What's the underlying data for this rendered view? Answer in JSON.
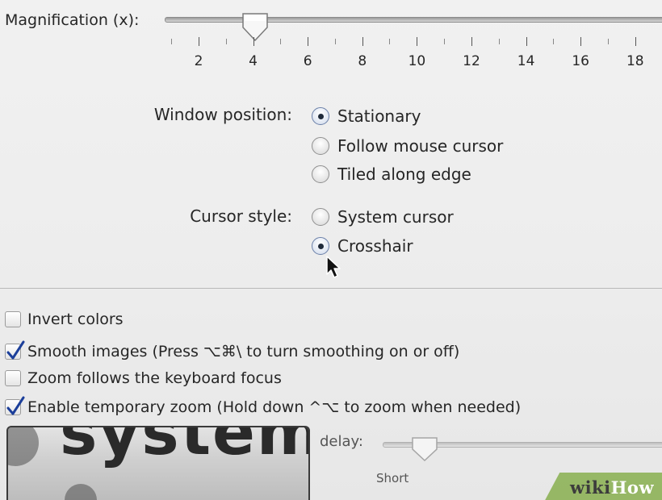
{
  "magnification": {
    "label": "Magnification (x):",
    "value": 4,
    "tick_labels": [
      "2",
      "4",
      "6",
      "8",
      "10",
      "12",
      "14",
      "16",
      "18"
    ]
  },
  "window_position": {
    "label": "Window position:",
    "options": [
      "Stationary",
      "Follow mouse cursor",
      "Tiled along edge"
    ],
    "selected": "Stationary"
  },
  "cursor_style": {
    "label": "Cursor style:",
    "options": [
      "System cursor",
      "Crosshair"
    ],
    "selected": "Crosshair"
  },
  "checkboxes": [
    {
      "label": "Invert colors",
      "checked": false
    },
    {
      "label": "Smooth images (Press ⌥⌘\\ to turn smoothing on or off)",
      "checked": true
    },
    {
      "label": "Zoom follows the keyboard focus",
      "checked": false
    },
    {
      "label": "Enable temporary zoom (Hold down ^⌥ to zoom when needed)",
      "checked": true
    }
  ],
  "preview": {
    "text": "system"
  },
  "delay": {
    "label": "delay:",
    "min_label": "Short"
  },
  "watermark": {
    "wiki": "wiki",
    "how": "How"
  },
  "colors": {
    "check": "#1c3f9a",
    "watermark": "#8fb35a"
  },
  "icons": {
    "pointer": "arrow-pointer-icon",
    "check": "checkmark-icon",
    "radio_dot": "radio-dot-icon"
  }
}
